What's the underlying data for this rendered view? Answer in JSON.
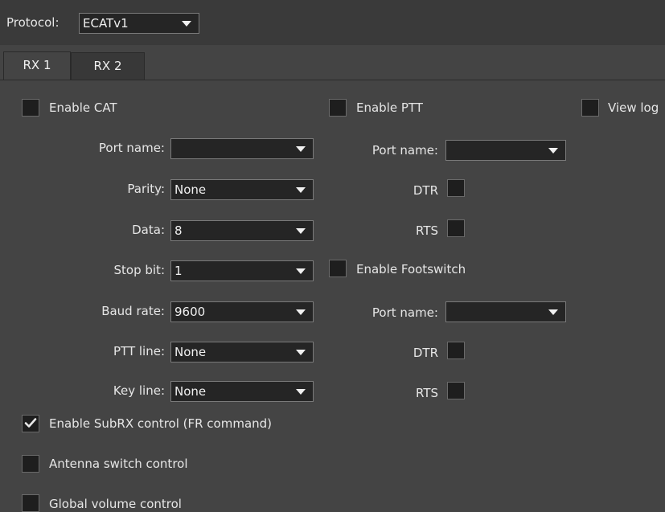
{
  "protocol": {
    "label": "Protocol:",
    "value": "ECATv1"
  },
  "tabs": [
    {
      "label": "RX 1"
    },
    {
      "label": "RX 2"
    }
  ],
  "cat": {
    "enable_label": "Enable CAT",
    "enabled": false,
    "port_name_label": "Port name:",
    "port_name_value": "",
    "parity_label": "Parity:",
    "parity_value": "None",
    "data_label": "Data:",
    "data_value": "8",
    "stop_bit_label": "Stop bit:",
    "stop_bit_value": "1",
    "baud_rate_label": "Baud rate:",
    "baud_rate_value": "9600",
    "ptt_line_label": "PTT line:",
    "ptt_line_value": "None",
    "key_line_label": "Key line:",
    "key_line_value": "None"
  },
  "ptt": {
    "enable_label": "Enable PTT",
    "enabled": false,
    "port_name_label": "Port name:",
    "port_name_value": "",
    "dtr_label": "DTR",
    "rts_label": "RTS"
  },
  "footswitch": {
    "enable_label": "Enable Footswitch",
    "enabled": false,
    "port_name_label": "Port name:",
    "port_name_value": "",
    "dtr_label": "DTR",
    "rts_label": "RTS"
  },
  "view_log": {
    "label": "View log",
    "checked": false
  },
  "options": {
    "subrx_label": "Enable SubRX control (FR command)",
    "subrx_checked": true,
    "antenna_label": "Antenna switch control",
    "antenna_checked": false,
    "volume_label": "Global volume control",
    "volume_checked": false
  }
}
